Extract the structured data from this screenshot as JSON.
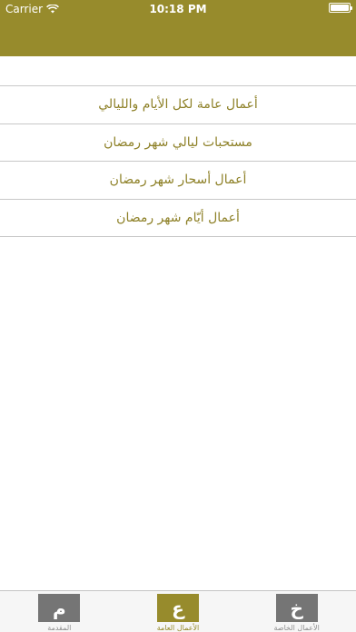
{
  "status_bar": {
    "carrier": "Carrier",
    "time": "10:18 PM"
  },
  "menu_items": [
    {
      "label": "أعمال عامة لكل الأيام والليالي"
    },
    {
      "label": "مستحبات ليالي شهر رمضان"
    },
    {
      "label": "أعمال أسحار شهر رمضان"
    },
    {
      "label": "أعمال أيّام شهر رمضان"
    }
  ],
  "tabs": [
    {
      "glyph": "م",
      "label": "المقدمة",
      "active": false
    },
    {
      "glyph": "ع",
      "label": "الأعمال العامة",
      "active": true
    },
    {
      "glyph": "خ",
      "label": "الأعمال الخاصة",
      "active": false
    }
  ],
  "colors": {
    "accent": "#978b2c",
    "text_accent": "#8e8128",
    "tab_icon_inactive": "#757575"
  }
}
